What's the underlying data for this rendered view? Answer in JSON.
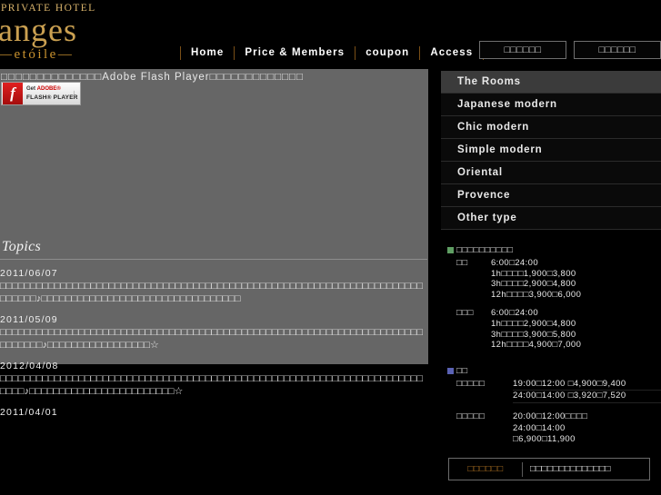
{
  "logo": {
    "top": "PRIVATE HOTEL",
    "main": "anges",
    "sub": "—etóile—"
  },
  "nav": {
    "items": [
      {
        "label": "Home"
      },
      {
        "label": "Price & Members"
      },
      {
        "label": "coupon"
      },
      {
        "label": "Access"
      }
    ],
    "buttons": [
      {
        "label": "□□□□□□"
      },
      {
        "label": "□□□□□□"
      }
    ]
  },
  "flash": {
    "notice_prefix": "□□□□□□□□□□□□□□",
    "notice_product": "Adobe Flash Player",
    "notice_suffix": "□□□□□□□□□□□□□",
    "badge_logo": "f",
    "badge_line1_get": "Get ",
    "badge_line1_brand": "ADOBE®",
    "badge_line2": "FLASH® PLAYER",
    "badge_arrow": "↓"
  },
  "sidebar": {
    "menu": [
      {
        "label": "The Rooms",
        "active": true
      },
      {
        "label": "Japanese modern",
        "active": false
      },
      {
        "label": "Chic modern",
        "active": false
      },
      {
        "label": "Simple modern",
        "active": false
      },
      {
        "label": "Oriental",
        "active": false
      },
      {
        "label": "Provence",
        "active": false
      },
      {
        "label": "Other type",
        "active": false
      }
    ],
    "price_sections": [
      {
        "bullet_color": "green",
        "heading": "□□□□□□□□□□",
        "groups": [
          {
            "label": "□□",
            "lines": [
              "6:00□24:00",
              "1h□□□□1,900□3,800",
              "3h□□□□2,900□4,800",
              "12h□□□□3,900□6,000"
            ]
          },
          {
            "label": "□□□",
            "lines": [
              "6:00□24:00",
              "1h□□□□2,900□4,800",
              "3h□□□□3,900□5,800",
              "12h□□□□4,900□7,000"
            ]
          }
        ]
      },
      {
        "bullet_color": "blue",
        "heading": "□□",
        "groups": [
          {
            "label": "□□□□□",
            "underline": true,
            "lines": [
              "19:00□12:00 □4,900□9,400",
              "24:00□14:00 □3,920□7,520"
            ]
          },
          {
            "label": "□□□□□",
            "underline": false,
            "lines": [
              "20:00□12:00□□□□",
              "24:00□14:00",
              "□6,900□11,900"
            ]
          }
        ]
      }
    ],
    "search": {
      "label": "□□□□□□",
      "value": "□□□□□□□□□□□□□□"
    }
  },
  "topics": {
    "title": "Topics",
    "items": [
      {
        "date": "2011/06/07",
        "body": "□□□□□□□□□□□□□□□□□□□□□□□□□□□□□□□□□□□□□□□□□□□□□□□□□□□□□□□□□□□□□□□□□□□□□□□□□□□□♪□□□□□□□□□□□□□□□□□□□□□□□□□□□□□□□□□"
      },
      {
        "date": "2011/05/09",
        "body": "□□□□□□□□□□□□□□□□□□□□□□□□□□□□□□□□□□□□□□□□□□□□□□□□□□□□□□□□□□□□□□□□□□□□□□□□□□□□□♪□□□□□□□□□□□□□□□□□☆"
      },
      {
        "date": "2012/04/08",
        "body": "□□□□□□□□□□□□□□□□□□□□□□□□□□□□□□□□□□□□□□□□□□□□□□□□□□□□□□□□□□□□□□□□□□□□□□□□□□♪□□□□□□□□□□□□□□□□□□□□□□□□☆"
      },
      {
        "date": "2011/04/01",
        "body": ""
      }
    ]
  }
}
